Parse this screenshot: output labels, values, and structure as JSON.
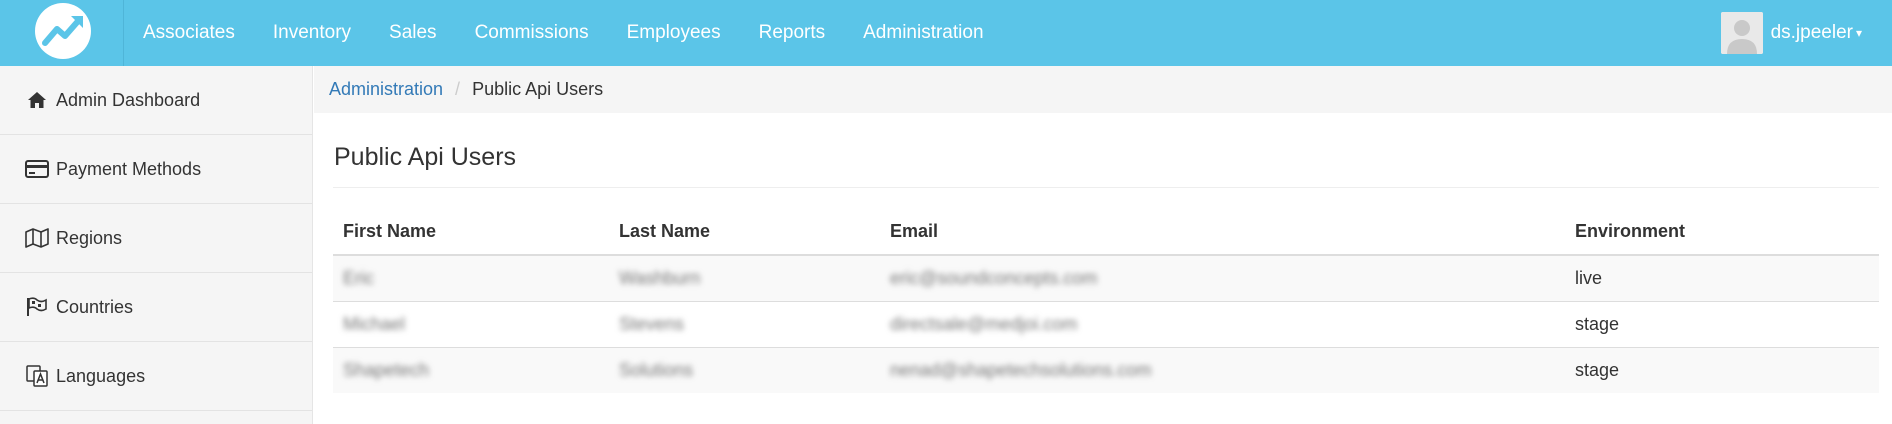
{
  "nav": {
    "links": [
      "Associates",
      "Inventory",
      "Sales",
      "Commissions",
      "Employees",
      "Reports",
      "Administration"
    ],
    "user_name": "ds.jpeeler",
    "caret": "▾"
  },
  "sidebar": {
    "items": [
      {
        "label": "Admin Dashboard",
        "icon": "home-icon"
      },
      {
        "label": "Payment Methods",
        "icon": "credit-card-icon"
      },
      {
        "label": "Regions",
        "icon": "map-icon"
      },
      {
        "label": "Countries",
        "icon": "flag-icon"
      },
      {
        "label": "Languages",
        "icon": "language-icon"
      }
    ]
  },
  "breadcrumb": {
    "parent": "Administration",
    "separator": "/",
    "current": "Public Api Users"
  },
  "main": {
    "title": "Public Api Users",
    "table": {
      "headers": [
        "First Name",
        "Last Name",
        "Email",
        "Environment"
      ],
      "rows": [
        [
          "Eric",
          "Washburn",
          "eric@soundconcepts.com",
          "live"
        ],
        [
          "Michael",
          "Stevens",
          "directsale@medjoi.com",
          "stage"
        ],
        [
          "Shapetech",
          "Solutions",
          "nenad@shapetechsolutions.com",
          "stage"
        ]
      ]
    }
  },
  "colors": {
    "navbar": "#5bc5e8",
    "link": "#337ab7",
    "sidebar_bg": "#f5f5f5"
  }
}
